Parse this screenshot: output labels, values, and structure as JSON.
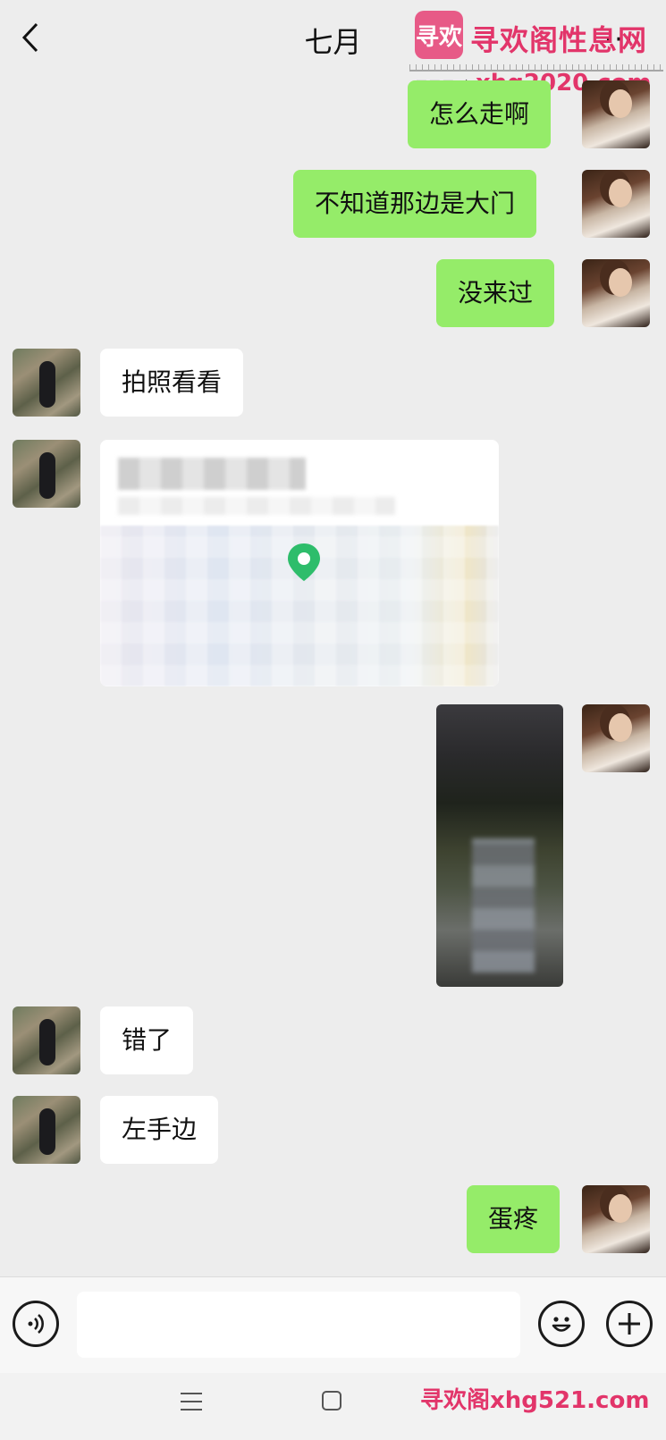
{
  "header": {
    "title": "七月",
    "more_label": "···"
  },
  "watermark": {
    "logo_text": "寻欢",
    "site_name": "寻欢阁性息网",
    "url_top": "xhg2020.com",
    "bottom_text": "寻欢阁xhg521.com"
  },
  "messages": [
    {
      "sender": "me",
      "text": "怎么走啊"
    },
    {
      "sender": "me",
      "text": "不知道那边是大门"
    },
    {
      "sender": "me",
      "text": "没来过"
    },
    {
      "sender": "her",
      "text": "拍照看看"
    },
    {
      "sender": "her",
      "type": "location"
    },
    {
      "sender": "me",
      "type": "video"
    },
    {
      "sender": "her",
      "text": "错了"
    },
    {
      "sender": "her",
      "text": "左手边"
    },
    {
      "sender": "me",
      "text": "蛋疼"
    }
  ],
  "input": {
    "value": "",
    "placeholder": ""
  },
  "colors": {
    "background": "#ededed",
    "bubble_me": "#95ec69",
    "bubble_her": "#ffffff",
    "map_pin": "#2ebd6b",
    "watermark": "#e2356a"
  },
  "icons": [
    "back-arrow-icon",
    "more-icon",
    "voice-icon",
    "emoji-icon",
    "plus-icon",
    "map-pin-icon",
    "nav-menu-icon",
    "nav-home-icon"
  ]
}
